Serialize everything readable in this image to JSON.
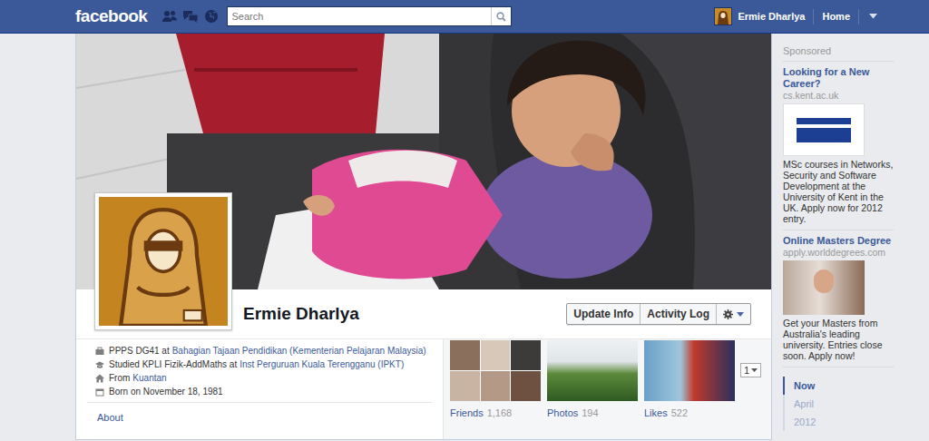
{
  "topbar": {
    "logo": "facebook",
    "search": {
      "placeholder": "Search"
    },
    "user": "Ermie Dharlya",
    "home": "Home"
  },
  "profile": {
    "name": "Ermie Dharlya",
    "buttons": [
      "Update Info",
      "Activity Log"
    ],
    "info": [
      {
        "kind": "work",
        "text": "PPPS DG41 at",
        "link": "Bahagian Tajaan Pendidikan (Kementerian Pelajaran Malaysia)"
      },
      {
        "kind": "education",
        "text": "Studied KPLI Fizik-AddMaths at",
        "link": "Inst Perguruan Kuala Terengganu (IPKT)"
      },
      {
        "kind": "home",
        "text": "From",
        "link": "Kuantan"
      },
      {
        "kind": "birthday",
        "text": "Born on November 18, 1981"
      }
    ],
    "about": "About",
    "tiles": [
      {
        "label": "Friends",
        "count": "1,168"
      },
      {
        "label": "Photos",
        "count": "194"
      },
      {
        "label": "Likes",
        "count": "522"
      }
    ],
    "pager": "1"
  },
  "sidebar": {
    "heading": "Sponsored",
    "ads": [
      {
        "title": "Looking for a New Career?",
        "domain": "cs.kent.ac.uk",
        "body": "MSc courses in Networks, Security and Software Development at the University of Kent in the UK. Apply now for 2012 entry."
      },
      {
        "title": "Online Masters Degree",
        "domain": "apply.worlddegrees.com",
        "body": "Get your Masters from Australia's leading university. Entries close soon. Apply now!"
      }
    ]
  },
  "scrubber": [
    {
      "label": "Now",
      "selected": true
    },
    {
      "label": "April",
      "selected": false
    },
    {
      "label": "2012",
      "selected": false
    }
  ]
}
